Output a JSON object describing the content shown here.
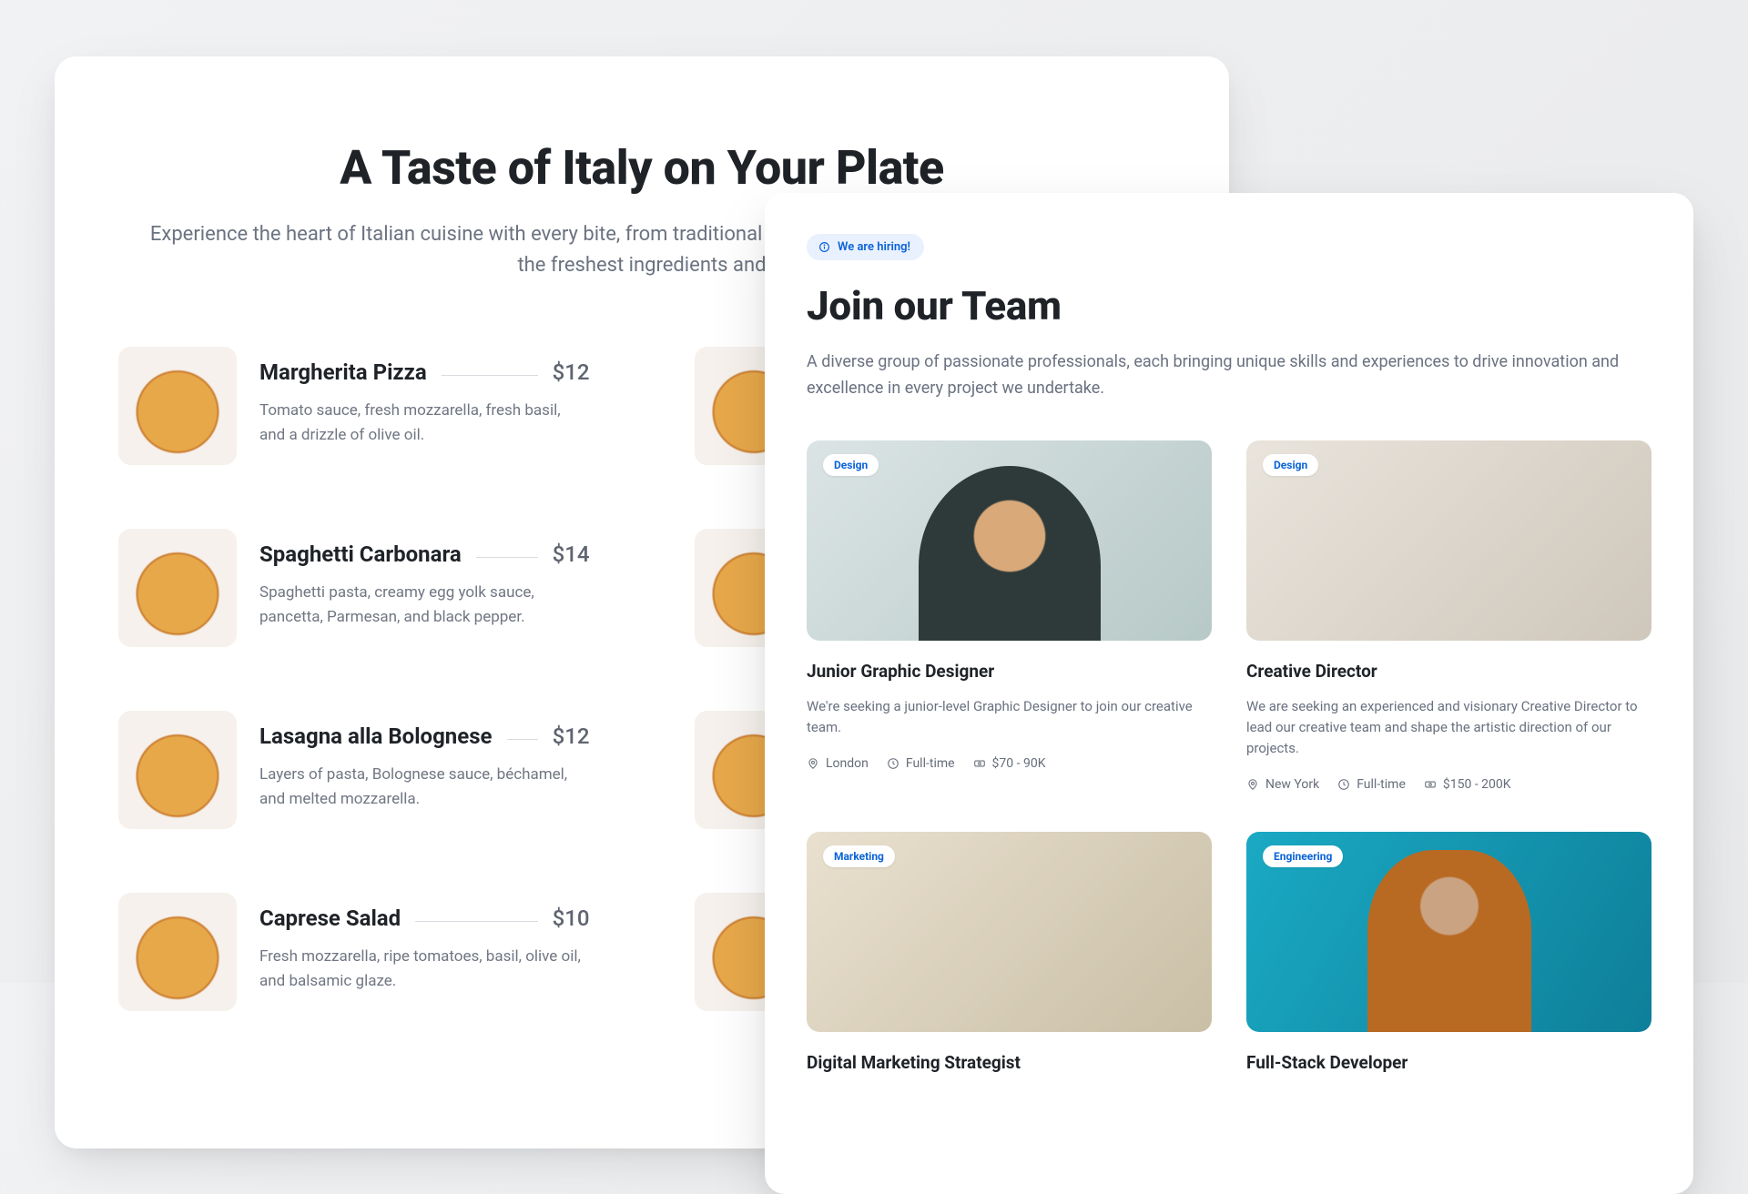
{
  "menu": {
    "title": "A Taste of Italy on Your Plate",
    "subtitle": "Experience the heart of Italian cuisine with every bite, from traditional recipes to modern classics, all made with the freshest ingredients and",
    "left": [
      {
        "name": "Margherita Pizza",
        "price": "$12",
        "desc": "Tomato sauce, fresh mozzarella, fresh basil, and a drizzle of olive oil."
      },
      {
        "name": "Spaghetti Carbonara",
        "price": "$14",
        "desc": "Spaghetti pasta, creamy egg yolk sauce, pancetta, Parmesan, and black pepper."
      },
      {
        "name": "Lasagna alla Bolognese",
        "price": "$12",
        "desc": "Layers of pasta, Bolognese sauce, béchamel, and melted mozzarella."
      },
      {
        "name": "Caprese Salad",
        "price": "$10",
        "desc": "Fresh mozzarella, ripe tomatoes, basil, olive oil, and balsamic glaze."
      }
    ],
    "right": [
      {
        "name": "",
        "price": "",
        "desc": ""
      },
      {
        "name": "",
        "price": "",
        "desc": ""
      },
      {
        "name": "",
        "price": "",
        "desc": ""
      },
      {
        "name": "",
        "price": "",
        "desc": ""
      }
    ]
  },
  "jobs": {
    "pill": "We are hiring!",
    "title": "Join our Team",
    "subtitle": "A diverse group of passionate professionals, each bringing unique skills and experiences to drive innovation and excellence in every project we undertake.",
    "items": [
      {
        "badge": "Design",
        "title": "Junior Graphic Designer",
        "desc": "We're seeking a junior-level Graphic Designer to join our creative team.",
        "loc": "London",
        "time": "Full-time",
        "pay": "$70 - 90K",
        "imgClass": "cat-design-1"
      },
      {
        "badge": "Design",
        "title": "Creative Director",
        "desc": "We are seeking an experienced and visionary Creative Director to lead our creative team and shape the artistic direction of our projects.",
        "loc": "New York",
        "time": "Full-time",
        "pay": "$150 - 200K",
        "imgClass": "cat-design-2"
      },
      {
        "badge": "Marketing",
        "title": "Digital Marketing Strategist",
        "desc": "",
        "loc": "",
        "time": "",
        "pay": "",
        "imgClass": "cat-marketing"
      },
      {
        "badge": "Engineering",
        "title": "Full-Stack Developer",
        "desc": "",
        "loc": "",
        "time": "",
        "pay": "",
        "imgClass": "cat-engineering"
      }
    ]
  }
}
